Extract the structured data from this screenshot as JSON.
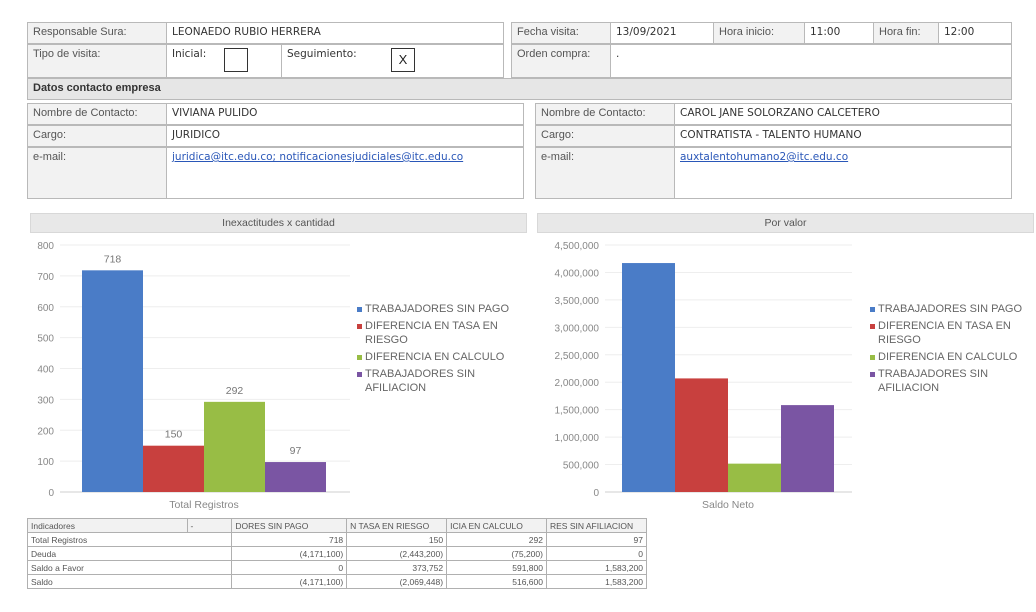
{
  "visit": {
    "responsable_label": "Responsable Sura:",
    "responsable_value": "LEONAEDO RUBIO HERRERA",
    "fecha_label": "Fecha visita:",
    "fecha_value": "13/09/2021",
    "hora_inicio_label": "Hora inicio:",
    "hora_inicio_value": "11:00",
    "hora_fin_label": "Hora fin:",
    "hora_fin_value": "12:00",
    "tipo_label": "Tipo de visita:",
    "inicial_label": "Inicial:",
    "inicial_mark": "",
    "seguimiento_label": "Seguimiento:",
    "seguimiento_mark": "X",
    "orden_label": "Orden compra:",
    "orden_value": "."
  },
  "contact": {
    "section_title": "Datos contacto empresa",
    "left": {
      "nombre_label": "Nombre de Contacto:",
      "nombre_value": "VIVIANA PULIDO",
      "cargo_label": "Cargo:",
      "cargo_value": "JURIDICO",
      "email_label": "e-mail:",
      "email_value": "juridica@itc.edu.co; notificacionesjudiciales@itc.edu.co"
    },
    "right": {
      "nombre_label": "Nombre de Contacto:",
      "nombre_value": "CAROL JANE SOLORZANO CALCETERO",
      "cargo_label": "Cargo:",
      "cargo_value": "CONTRATISTA - TALENTO HUMANO",
      "email_label": "e-mail:",
      "email_value": "auxtalentohumano2@itc.edu.co"
    }
  },
  "colors": {
    "blue": "#4a7cc7",
    "red": "#c8403e",
    "green": "#98bd45",
    "purple": "#7a55a3"
  },
  "chart_data": [
    {
      "type": "bar",
      "title": "Inexactitudes x cantidad",
      "categories": [
        "Total Registros"
      ],
      "series": [
        {
          "name": "TRABAJADORES SIN PAGO",
          "values": [
            718
          ]
        },
        {
          "name": "DIFERENCIA EN TASA EN RIESGO",
          "values": [
            150
          ]
        },
        {
          "name": "DIFERENCIA EN CALCULO",
          "values": [
            292
          ]
        },
        {
          "name": "TRABAJADORES SIN AFILIACION",
          "values": [
            97
          ]
        }
      ],
      "data_labels": [
        "718",
        "150",
        "292",
        "97"
      ],
      "ylim": [
        0,
        800
      ],
      "yticks": [
        "0",
        "100",
        "200",
        "300",
        "400",
        "500",
        "600",
        "700",
        "800"
      ],
      "legend_position": "right"
    },
    {
      "type": "bar",
      "title": "Por valor",
      "categories": [
        "Saldo Neto"
      ],
      "series": [
        {
          "name": "TRABAJADORES SIN PAGO",
          "values": [
            4171100
          ]
        },
        {
          "name": "DIFERENCIA EN TASA EN RIESGO",
          "values": [
            2069448
          ]
        },
        {
          "name": "DIFERENCIA EN CALCULO",
          "values": [
            516600
          ]
        },
        {
          "name": "TRABAJADORES SIN AFILIACION",
          "values": [
            1583200
          ]
        }
      ],
      "ylim": [
        0,
        4500000
      ],
      "yticks": [
        "0",
        "500,000",
        "1,000,000",
        "1,500,000",
        "2,000,000",
        "2,500,000",
        "3,000,000",
        "3,500,000",
        "4,000,000",
        "4,500,000"
      ],
      "legend_position": "right"
    }
  ],
  "indicators": {
    "headers": [
      "Indicadores",
      "-",
      "DORES SIN PAGO",
      "N TASA EN RIESGO",
      "ICIA EN CALCULO",
      "RES SIN AFILIACION"
    ],
    "rows": [
      [
        "Total Registros",
        "718",
        "150",
        "292",
        "97"
      ],
      [
        "Deuda",
        "(4,171,100)",
        "(2,443,200)",
        "(75,200)",
        "0"
      ],
      [
        "Saldo a Favor",
        "0",
        "373,752",
        "591,800",
        "1,583,200"
      ],
      [
        "Saldo",
        "(4,171,100)",
        "(2,069,448)",
        "516,600",
        "1,583,200"
      ]
    ]
  }
}
